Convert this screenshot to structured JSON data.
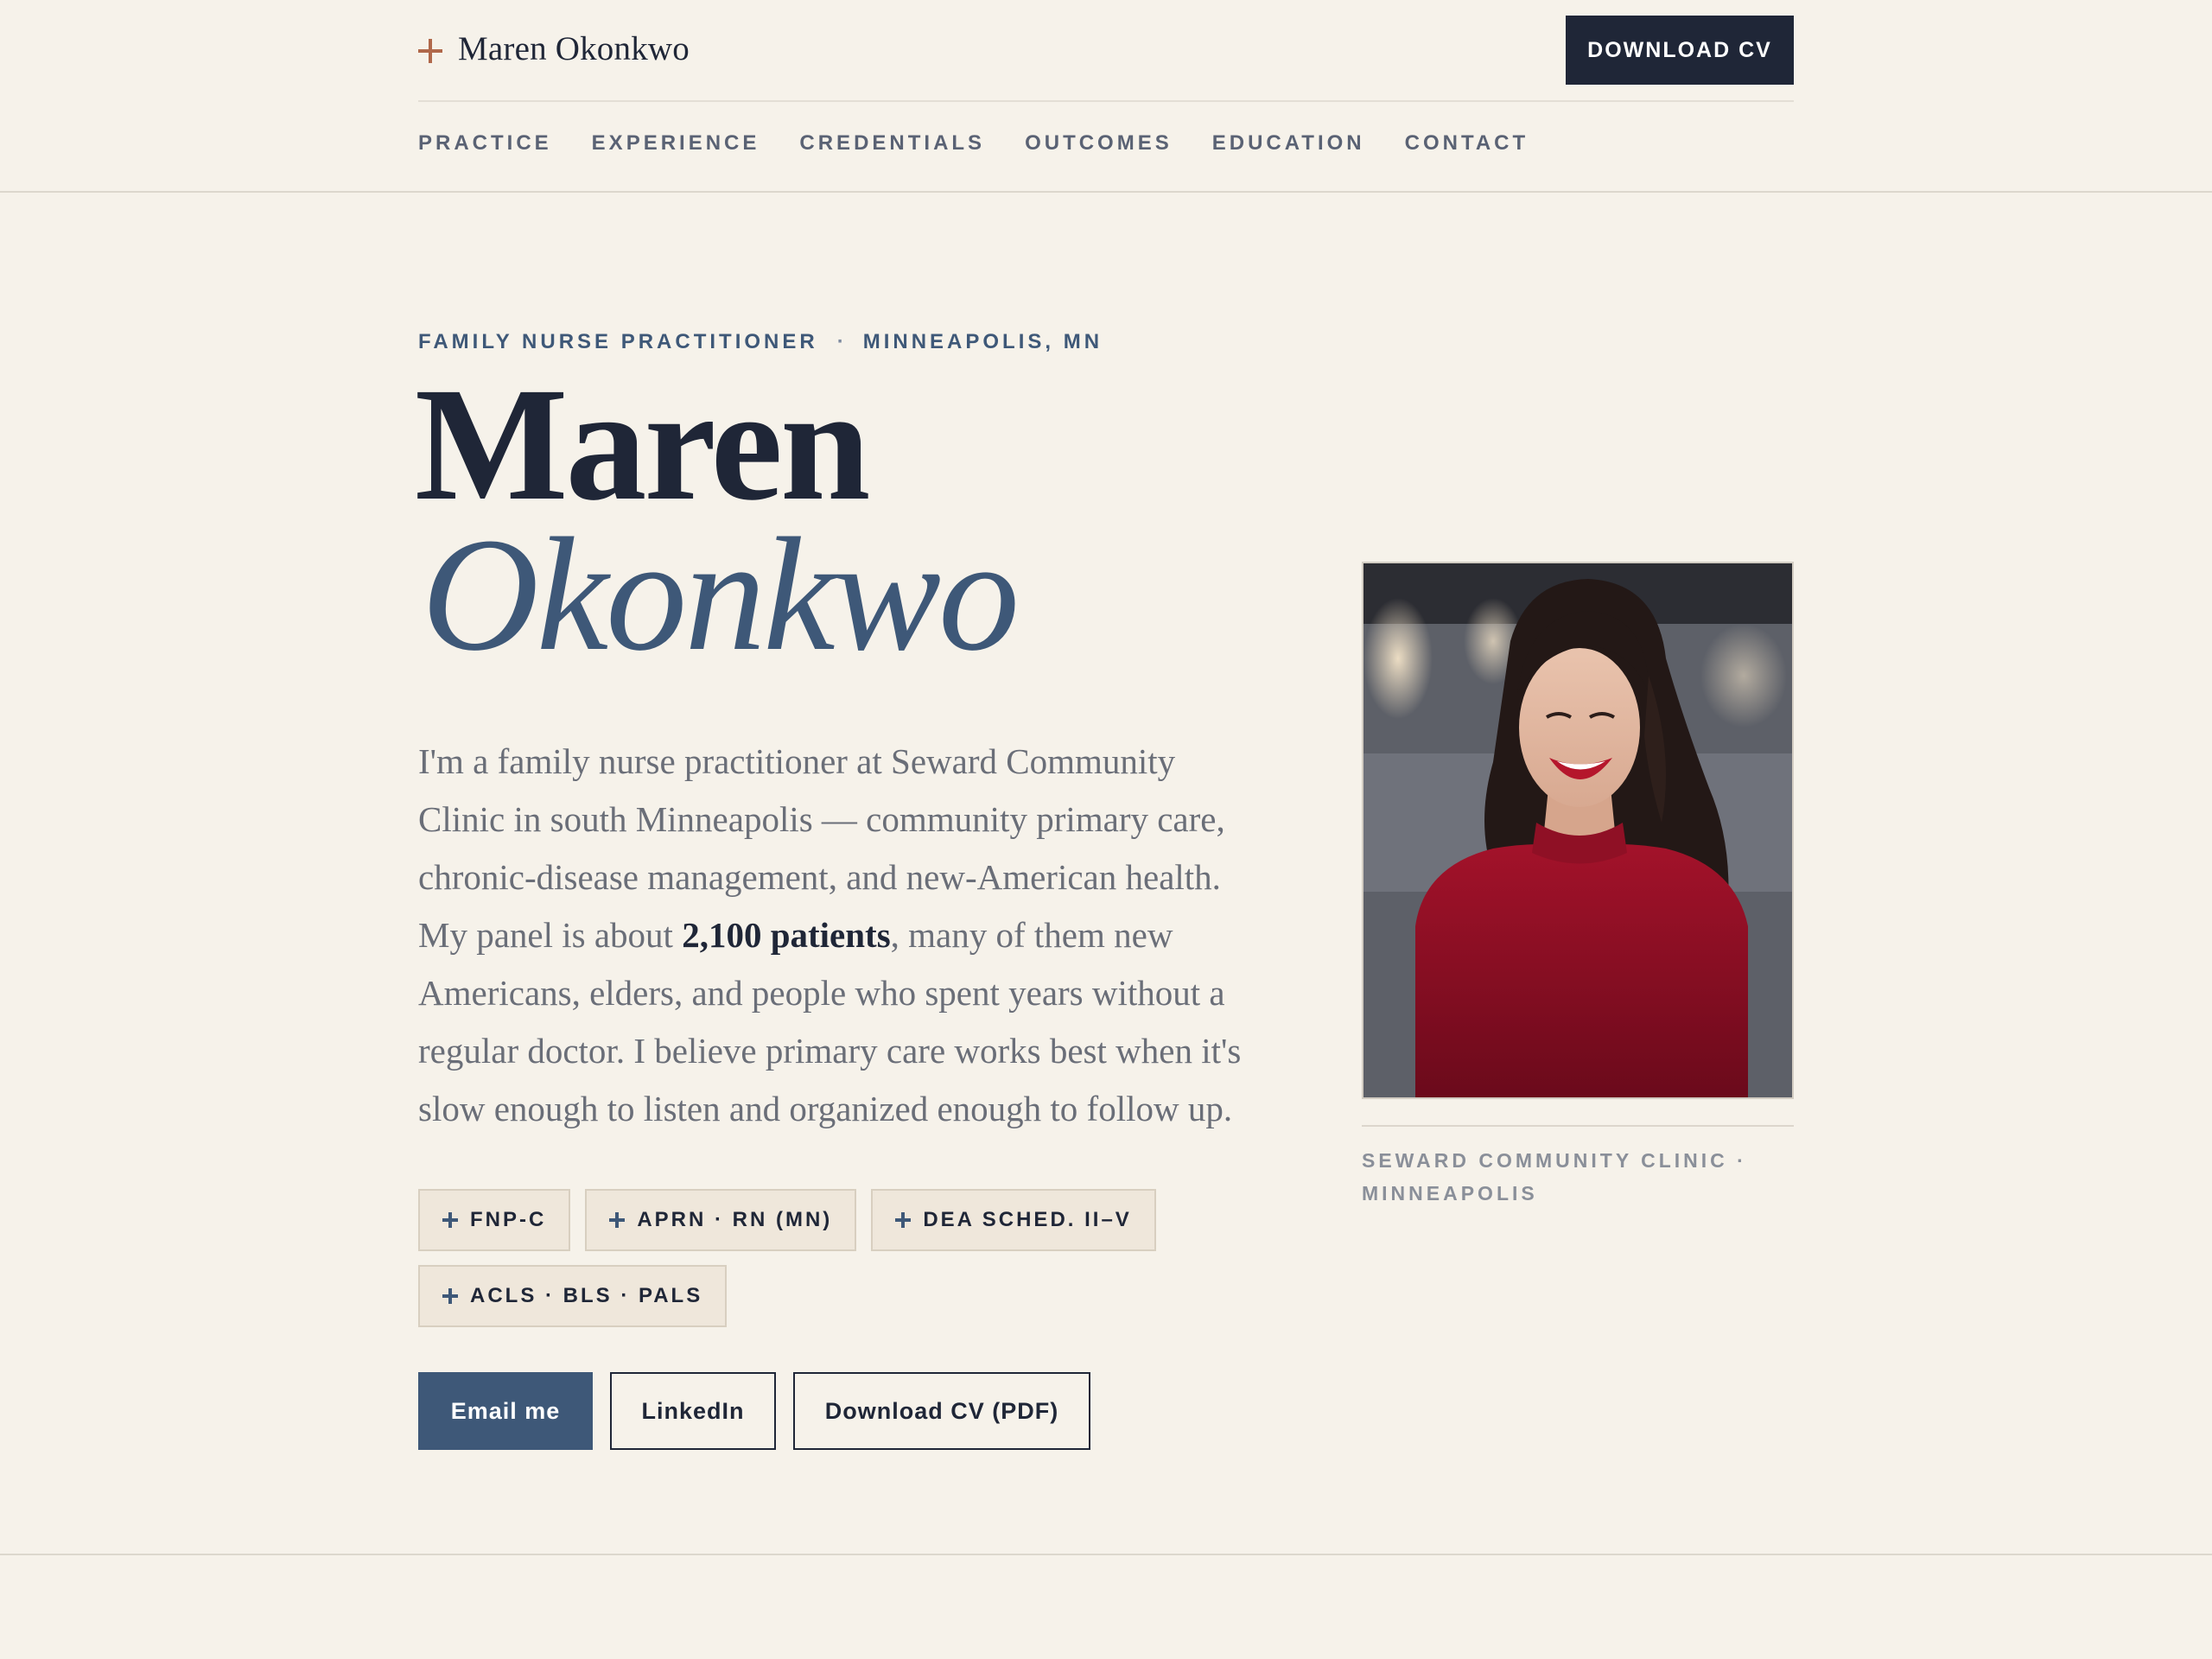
{
  "header": {
    "brand_name": "Maren Okonkwo",
    "download_label": "DOWNLOAD CV",
    "nav": [
      "PRACTICE",
      "EXPERIENCE",
      "CREDENTIALS",
      "OUTCOMES",
      "EDUCATION",
      "CONTACT"
    ]
  },
  "hero": {
    "eyebrow_role": "FAMILY NURSE PRACTITIONER",
    "eyebrow_separator": "·",
    "eyebrow_location": "MINNEAPOLIS, MN",
    "first_name": "Maren",
    "last_name": "Okonkwo",
    "bio_part1": "I'm a family nurse practitioner at Seward Community Clinic in south Minneapolis — community primary care, chronic-disease management, and new-American health. My panel is about ",
    "bio_highlight": "2,100 patients",
    "bio_part2": ", many of them new Americans, elders, and people who spent years without a regular doctor. I believe primary care works best when it's slow enough to listen and organized enough to follow up.",
    "badges": [
      "FNP-C",
      "APRN · RN (MN)",
      "DEA SCHED. II–V",
      "ACLS · BLS · PALS"
    ],
    "actions": {
      "email": "Email me",
      "linkedin": "LinkedIn",
      "cv": "Download CV (PDF)"
    }
  },
  "portrait": {
    "caption": "SEWARD COMMUNITY CLINIC · MINNEAPOLIS"
  },
  "colors": {
    "background": "#f6f2ea",
    "ink": "#1f2637",
    "accent_blue": "#3e5878",
    "accent_rust": "#b0684a",
    "badge_bg": "#efe7db"
  }
}
